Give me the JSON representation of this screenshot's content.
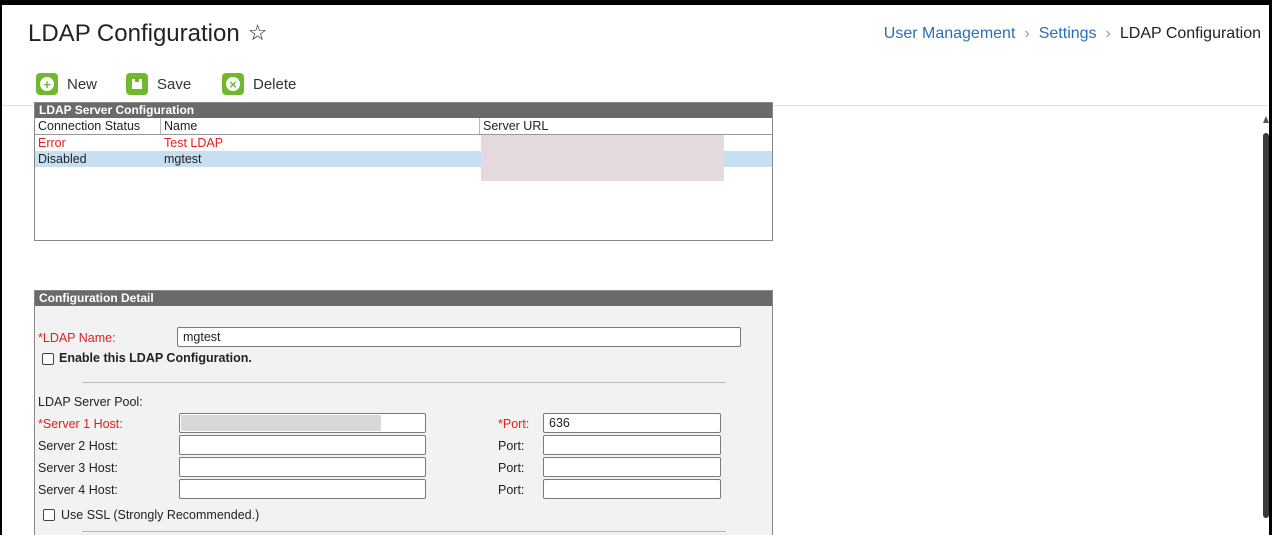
{
  "header": {
    "title": "LDAP Configuration",
    "breadcrumb": [
      "User Management",
      "Settings",
      "LDAP Configuration"
    ]
  },
  "toolbar": {
    "new_label": "New",
    "save_label": "Save",
    "delete_label": "Delete"
  },
  "server_panel": {
    "title": "LDAP Server Configuration",
    "columns": [
      "Connection Status",
      "Name",
      "Server URL"
    ],
    "rows": [
      {
        "status": "Error",
        "name": "Test LDAP",
        "url": ""
      },
      {
        "status": "Disabled",
        "name": "mgtest",
        "url": ""
      }
    ]
  },
  "detail": {
    "title": "Configuration Detail",
    "ldap_name_label": "*LDAP Name:",
    "ldap_name_value": "mgtest",
    "enable_label": "Enable this LDAP Configuration.",
    "pool_label": "LDAP Server Pool:",
    "hosts": [
      {
        "label": "*Server 1 Host:",
        "required": true,
        "value": "",
        "port_label": "*Port:",
        "port_value": "636"
      },
      {
        "label": "Server 2 Host:",
        "required": false,
        "value": "",
        "port_label": "Port:",
        "port_value": ""
      },
      {
        "label": "Server 3 Host:",
        "required": false,
        "value": "",
        "port_label": "Port:",
        "port_value": ""
      },
      {
        "label": "Server 4 Host:",
        "required": false,
        "value": "",
        "port_label": "Port:",
        "port_value": ""
      }
    ],
    "ssl_label": "Use SSL (Strongly Recommended.)"
  },
  "colors": {
    "accent_green": "#72b82e",
    "link_blue": "#2a6eb8",
    "error_red": "#e02020",
    "selected_row": "#c7dff0"
  }
}
